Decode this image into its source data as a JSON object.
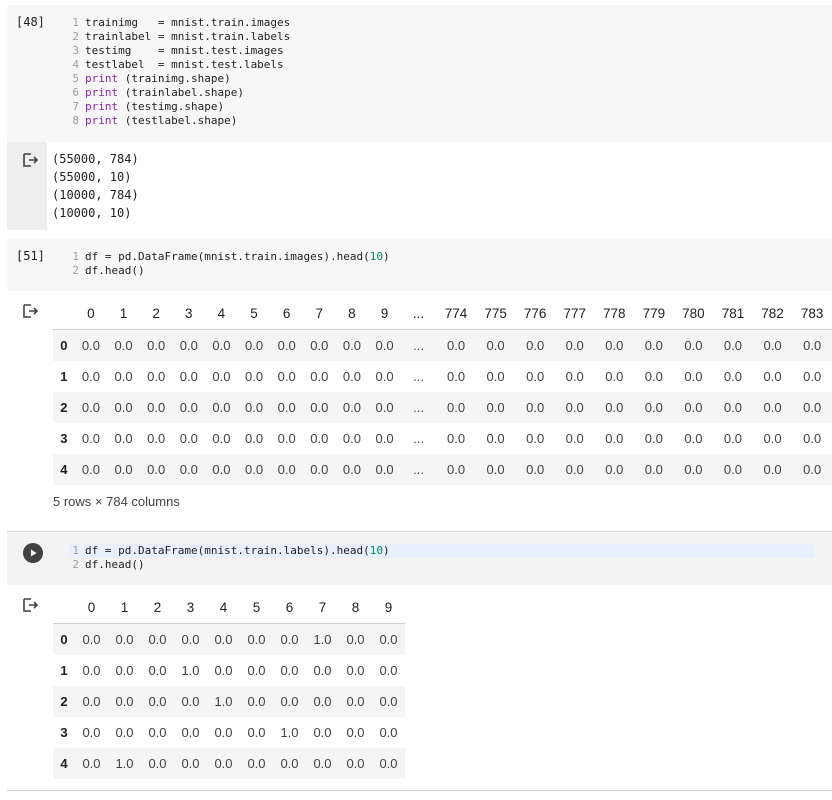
{
  "cell1": {
    "exec_count": "[48]",
    "lines": [
      {
        "n": "1",
        "parts": [
          {
            "t": "trainimg   = mnist.train.images",
            "c": ""
          }
        ]
      },
      {
        "n": "2",
        "parts": [
          {
            "t": "trainlabel = mnist.train.labels",
            "c": ""
          }
        ]
      },
      {
        "n": "3",
        "parts": [
          {
            "t": "testimg    = mnist.test.images",
            "c": ""
          }
        ]
      },
      {
        "n": "4",
        "parts": [
          {
            "t": "testlabel  = mnist.test.labels",
            "c": ""
          }
        ]
      },
      {
        "n": "5",
        "parts": [
          {
            "t": "print",
            "c": "kw"
          },
          {
            "t": " (trainimg.shape)",
            "c": ""
          }
        ]
      },
      {
        "n": "6",
        "parts": [
          {
            "t": "print",
            "c": "kw"
          },
          {
            "t": " (trainlabel.shape)",
            "c": ""
          }
        ]
      },
      {
        "n": "7",
        "parts": [
          {
            "t": "print",
            "c": "kw"
          },
          {
            "t": " (testimg.shape)",
            "c": ""
          }
        ]
      },
      {
        "n": "8",
        "parts": [
          {
            "t": "print",
            "c": "kw"
          },
          {
            "t": " (testlabel.shape)",
            "c": ""
          }
        ]
      }
    ],
    "output": "(55000, 784)\n(55000, 10)\n(10000, 784)\n(10000, 10)"
  },
  "cell2": {
    "exec_count": "[51]",
    "lines": [
      {
        "n": "1",
        "parts": [
          {
            "t": "df = pd.DataFrame(mnist.train.images).head(",
            "c": ""
          },
          {
            "t": "10",
            "c": "num"
          },
          {
            "t": ")",
            "c": ""
          }
        ]
      },
      {
        "n": "2",
        "parts": [
          {
            "t": "df.head()",
            "c": ""
          }
        ]
      }
    ],
    "table": {
      "columns": [
        "0",
        "1",
        "2",
        "3",
        "4",
        "5",
        "6",
        "7",
        "8",
        "9",
        "...",
        "774",
        "775",
        "776",
        "777",
        "778",
        "779",
        "780",
        "781",
        "782",
        "783"
      ],
      "rows": [
        {
          "index": "0",
          "values": [
            "0.0",
            "0.0",
            "0.0",
            "0.0",
            "0.0",
            "0.0",
            "0.0",
            "0.0",
            "0.0",
            "0.0",
            "...",
            "0.0",
            "0.0",
            "0.0",
            "0.0",
            "0.0",
            "0.0",
            "0.0",
            "0.0",
            "0.0",
            "0.0"
          ]
        },
        {
          "index": "1",
          "values": [
            "0.0",
            "0.0",
            "0.0",
            "0.0",
            "0.0",
            "0.0",
            "0.0",
            "0.0",
            "0.0",
            "0.0",
            "...",
            "0.0",
            "0.0",
            "0.0",
            "0.0",
            "0.0",
            "0.0",
            "0.0",
            "0.0",
            "0.0",
            "0.0"
          ]
        },
        {
          "index": "2",
          "values": [
            "0.0",
            "0.0",
            "0.0",
            "0.0",
            "0.0",
            "0.0",
            "0.0",
            "0.0",
            "0.0",
            "0.0",
            "...",
            "0.0",
            "0.0",
            "0.0",
            "0.0",
            "0.0",
            "0.0",
            "0.0",
            "0.0",
            "0.0",
            "0.0"
          ]
        },
        {
          "index": "3",
          "values": [
            "0.0",
            "0.0",
            "0.0",
            "0.0",
            "0.0",
            "0.0",
            "0.0",
            "0.0",
            "0.0",
            "0.0",
            "...",
            "0.0",
            "0.0",
            "0.0",
            "0.0",
            "0.0",
            "0.0",
            "0.0",
            "0.0",
            "0.0",
            "0.0"
          ]
        },
        {
          "index": "4",
          "values": [
            "0.0",
            "0.0",
            "0.0",
            "0.0",
            "0.0",
            "0.0",
            "0.0",
            "0.0",
            "0.0",
            "0.0",
            "...",
            "0.0",
            "0.0",
            "0.0",
            "0.0",
            "0.0",
            "0.0",
            "0.0",
            "0.0",
            "0.0",
            "0.0"
          ]
        }
      ],
      "note": "5 rows × 784 columns"
    }
  },
  "cell3": {
    "lines": [
      {
        "n": "1",
        "parts": [
          {
            "t": "df = pd.DataFrame(mnist.train.labels).head(",
            "c": ""
          },
          {
            "t": "10",
            "c": "num"
          },
          {
            "t": ")",
            "c": ""
          }
        ]
      },
      {
        "n": "2",
        "parts": [
          {
            "t": "df.head()",
            "c": ""
          }
        ]
      }
    ],
    "table": {
      "columns": [
        "0",
        "1",
        "2",
        "3",
        "4",
        "5",
        "6",
        "7",
        "8",
        "9"
      ],
      "rows": [
        {
          "index": "0",
          "values": [
            "0.0",
            "0.0",
            "0.0",
            "0.0",
            "0.0",
            "0.0",
            "0.0",
            "1.0",
            "0.0",
            "0.0"
          ]
        },
        {
          "index": "1",
          "values": [
            "0.0",
            "0.0",
            "0.0",
            "1.0",
            "0.0",
            "0.0",
            "0.0",
            "0.0",
            "0.0",
            "0.0"
          ]
        },
        {
          "index": "2",
          "values": [
            "0.0",
            "0.0",
            "0.0",
            "0.0",
            "1.0",
            "0.0",
            "0.0",
            "0.0",
            "0.0",
            "0.0"
          ]
        },
        {
          "index": "3",
          "values": [
            "0.0",
            "0.0",
            "0.0",
            "0.0",
            "0.0",
            "0.0",
            "1.0",
            "0.0",
            "0.0",
            "0.0"
          ]
        },
        {
          "index": "4",
          "values": [
            "0.0",
            "1.0",
            "0.0",
            "0.0",
            "0.0",
            "0.0",
            "0.0",
            "0.0",
            "0.0",
            "0.0"
          ]
        }
      ]
    }
  },
  "icons": {
    "output": "output-arrow-icon",
    "run": "play-icon"
  },
  "colors": {
    "keyword": "#8e24aa",
    "number": "#098658",
    "cell_bg": "#f7f7f7"
  }
}
